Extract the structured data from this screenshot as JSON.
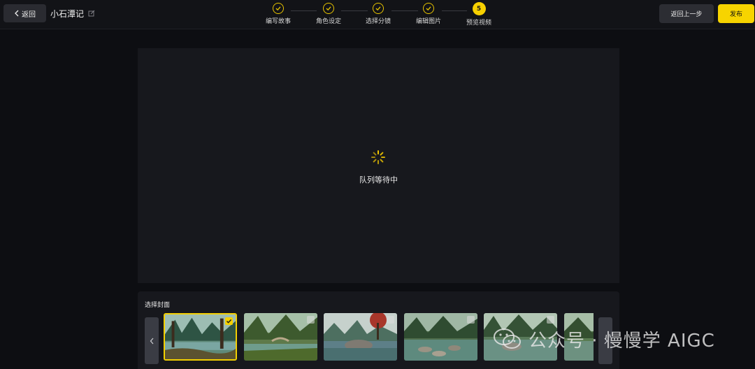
{
  "header": {
    "back_label": "返回",
    "project_title": "小石潭记",
    "prev_step_label": "返回上一步",
    "publish_label": "发布"
  },
  "steps": [
    {
      "label": "编写故事",
      "status": "done"
    },
    {
      "label": "角色设定",
      "status": "done"
    },
    {
      "label": "选择分镜",
      "status": "done"
    },
    {
      "label": "编辑图片",
      "status": "done"
    },
    {
      "label": "预览视频",
      "status": "current",
      "number": "5"
    }
  ],
  "preview": {
    "status_text": "队列等待中"
  },
  "cover": {
    "title": "选择封面",
    "selected_index": 0
  },
  "watermark": {
    "text": "公众号 · 慢慢学 AIGC"
  },
  "colors": {
    "accent": "#f7d400",
    "background": "#0d0e12",
    "panel": "#17181d"
  }
}
